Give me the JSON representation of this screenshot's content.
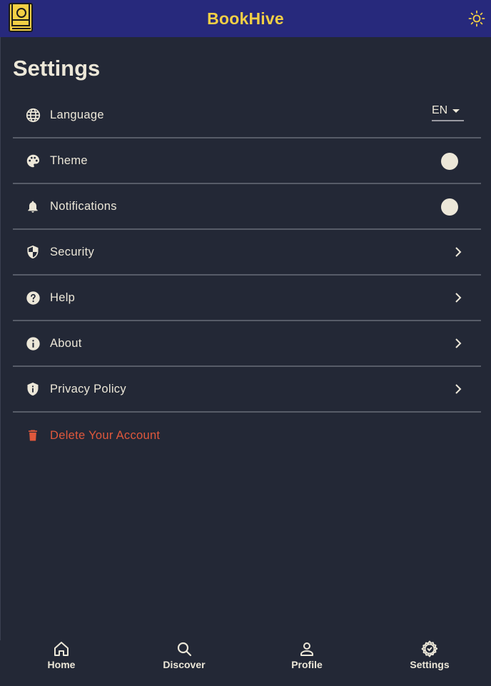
{
  "app": {
    "title": "BookHive",
    "logo_icon": "book-logo-icon",
    "theme_toggle_icon": "sun-icon"
  },
  "colors": {
    "app_bar": "#27297c",
    "title": "#f2cf45",
    "background": "#232836",
    "danger": "#e0583c",
    "text": "#ece7d8"
  },
  "page": {
    "title": "Settings"
  },
  "settings": {
    "language": {
      "label": "Language",
      "icon": "globe-icon",
      "value": "EN"
    },
    "theme": {
      "label": "Theme",
      "icon": "palette-icon",
      "enabled": false
    },
    "notifications": {
      "label": "Notifications",
      "icon": "bell-icon",
      "enabled": false
    },
    "security": {
      "label": "Security",
      "icon": "shield-icon"
    },
    "help": {
      "label": "Help",
      "icon": "help-circle-icon"
    },
    "about": {
      "label": "About",
      "icon": "info-icon"
    },
    "privacy": {
      "label": "Privacy Policy",
      "icon": "privacy-shield-icon"
    },
    "delete_account": {
      "label": "Delete Your Account",
      "icon": "trash-icon"
    }
  },
  "bottom_nav": {
    "home": {
      "label": "Home",
      "icon": "home-icon"
    },
    "discover": {
      "label": "Discover",
      "icon": "search-icon"
    },
    "profile": {
      "label": "Profile",
      "icon": "person-icon"
    },
    "settings": {
      "label": "Settings",
      "icon": "gear-icon"
    }
  }
}
